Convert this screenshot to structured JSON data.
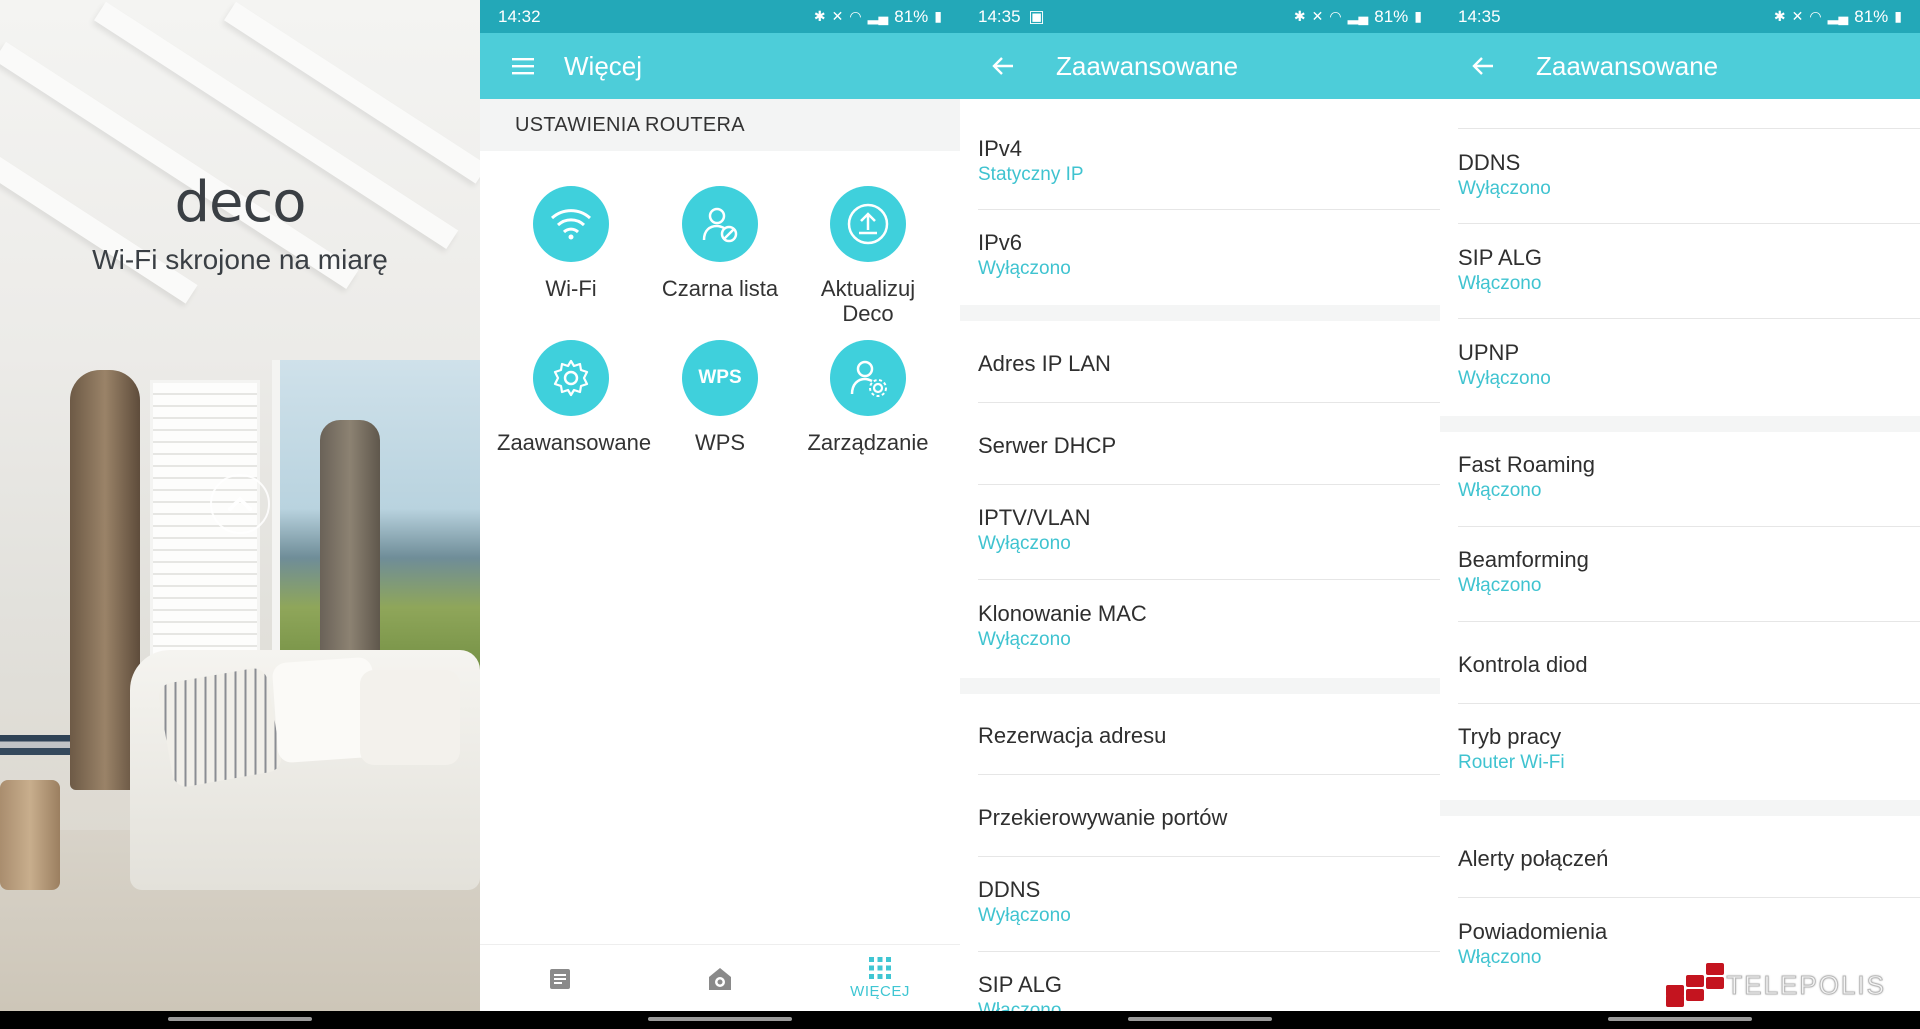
{
  "status": {
    "p2_time": "14:32",
    "p3_time": "14:35",
    "p4_time": "14:35",
    "battery": "81%"
  },
  "splash": {
    "logo": "deco",
    "tagline": "Wi-Fi skrojone na miarę"
  },
  "more": {
    "title": "Więcej",
    "section": "USTAWIENIA ROUTERA",
    "tiles": [
      {
        "label": "Wi-Fi",
        "icon": "wifi-icon"
      },
      {
        "label": "Czarna lista",
        "icon": "blocked-user-icon"
      },
      {
        "label": "Aktualizuj Deco",
        "icon": "upload-icon"
      },
      {
        "label": "Zaawansowane",
        "icon": "gear-icon"
      },
      {
        "label": "WPS",
        "icon": "wps-icon"
      },
      {
        "label": "Zarządzanie",
        "icon": "user-gear-icon"
      }
    ],
    "bottom_nav": {
      "more_label": "WIĘCEJ"
    }
  },
  "advanced1": {
    "title": "Zaawansowane",
    "items": [
      {
        "title": "IPv4",
        "sub": "Statyczny IP"
      },
      {
        "title": "IPv6",
        "sub": "Wyłączono"
      },
      {
        "title": "Adres IP LAN",
        "sub": ""
      },
      {
        "title": "Serwer DHCP",
        "sub": ""
      },
      {
        "title": "IPTV/VLAN",
        "sub": "Wyłączono"
      },
      {
        "title": "Klonowanie MAC",
        "sub": "Wyłączono"
      },
      {
        "title": "Rezerwacja adresu",
        "sub": ""
      },
      {
        "title": "Przekierowywanie portów",
        "sub": ""
      },
      {
        "title": "DDNS",
        "sub": "Wyłączono"
      },
      {
        "title": "SIP ALG",
        "sub": "Włączono"
      }
    ]
  },
  "advanced2": {
    "title": "Zaawansowane",
    "items": [
      {
        "title": "DDNS",
        "sub": "Wyłączono"
      },
      {
        "title": "SIP ALG",
        "sub": "Włączono"
      },
      {
        "title": "UPNP",
        "sub": "Wyłączono"
      },
      {
        "title": "Fast Roaming",
        "sub": "Włączono"
      },
      {
        "title": "Beamforming",
        "sub": "Włączono"
      },
      {
        "title": "Kontrola diod",
        "sub": ""
      },
      {
        "title": "Tryb pracy",
        "sub": "Router Wi-Fi"
      },
      {
        "title": "Alerty połączeń",
        "sub": ""
      },
      {
        "title": "Powiadomienia",
        "sub": "Włączono"
      }
    ]
  },
  "watermark": "TELEPOLIS",
  "colors": {
    "statusbar": "#23a8b8",
    "appbar": "#4dcdd9",
    "accent": "#3fc3d0"
  }
}
